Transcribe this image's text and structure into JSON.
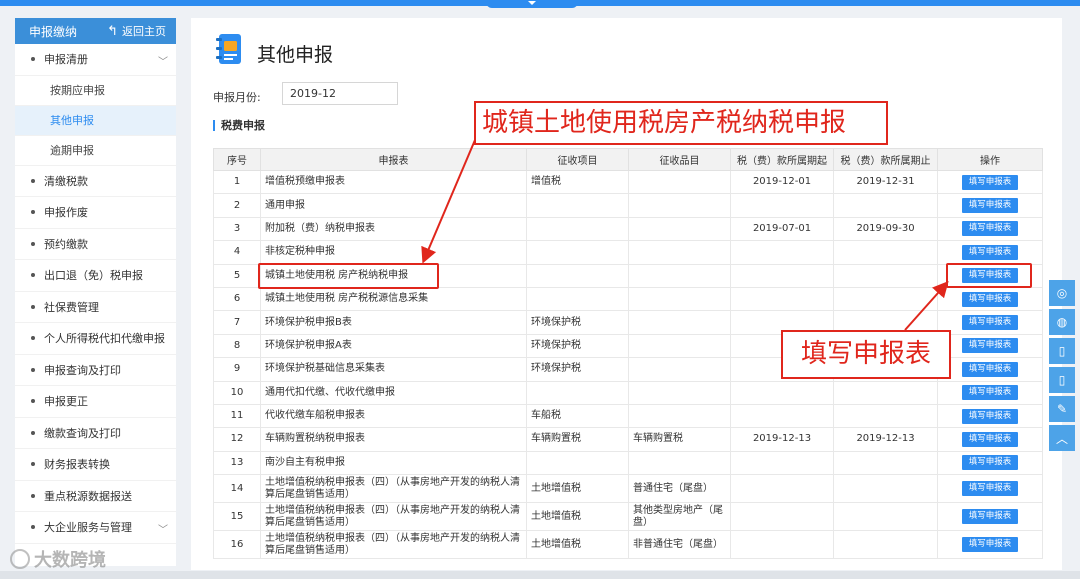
{
  "sidebar": {
    "header_title": "申报缴纳",
    "home_label": "返回主页",
    "items": [
      {
        "label": "申报清册",
        "expanded": true,
        "children": [
          {
            "label": "按期应申报"
          },
          {
            "label": "其他申报",
            "active": true
          },
          {
            "label": "逾期申报"
          }
        ]
      },
      {
        "label": "清缴税款"
      },
      {
        "label": "申报作废"
      },
      {
        "label": "预约缴款"
      },
      {
        "label": "出口退（免）税申报"
      },
      {
        "label": "社保费管理"
      },
      {
        "label": "个人所得税代扣代缴申报"
      },
      {
        "label": "申报查询及打印"
      },
      {
        "label": "申报更正"
      },
      {
        "label": "缴款查询及打印"
      },
      {
        "label": "财务报表转换"
      },
      {
        "label": "重点税源数据报送"
      },
      {
        "label": "大企业服务与管理",
        "expandable": true
      }
    ]
  },
  "main": {
    "title": "其他申报",
    "month_label": "申报月份:",
    "month_value": "2019-12",
    "section_title": "税费申报",
    "table": {
      "headers": [
        "序号",
        "申报表",
        "征收项目",
        "征收品目",
        "税（费）款所属期起",
        "税（费）款所属期止",
        "操作"
      ],
      "action_label": "填写申报表",
      "rows": [
        {
          "no": "1",
          "form": "增值税预缴申报表",
          "item": "增值税",
          "sub": "",
          "start": "2019-12-01",
          "end": "2019-12-31"
        },
        {
          "no": "2",
          "form": "通用申报",
          "item": "",
          "sub": "",
          "start": "",
          "end": ""
        },
        {
          "no": "3",
          "form": "附加税（费）纳税申报表",
          "item": "",
          "sub": "",
          "start": "2019-07-01",
          "end": "2019-09-30"
        },
        {
          "no": "4",
          "form": "非核定税种申报",
          "item": "",
          "sub": "",
          "start": "",
          "end": ""
        },
        {
          "no": "5",
          "form": "城镇土地使用税 房产税纳税申报",
          "item": "",
          "sub": "",
          "start": "",
          "end": ""
        },
        {
          "no": "6",
          "form": "城镇土地使用税 房产税税源信息采集",
          "item": "",
          "sub": "",
          "start": "",
          "end": ""
        },
        {
          "no": "7",
          "form": "环境保护税申报B表",
          "item": "环境保护税",
          "sub": "",
          "start": "",
          "end": ""
        },
        {
          "no": "8",
          "form": "环境保护税申报A表",
          "item": "环境保护税",
          "sub": "",
          "start": "",
          "end": ""
        },
        {
          "no": "9",
          "form": "环境保护税基础信息采集表",
          "item": "环境保护税",
          "sub": "",
          "start": "",
          "end": ""
        },
        {
          "no": "10",
          "form": "通用代扣代缴、代收代缴申报",
          "item": "",
          "sub": "",
          "start": "",
          "end": ""
        },
        {
          "no": "11",
          "form": "代收代缴车船税申报表",
          "item": "车船税",
          "sub": "",
          "start": "",
          "end": ""
        },
        {
          "no": "12",
          "form": "车辆购置税纳税申报表",
          "item": "车辆购置税",
          "sub": "车辆购置税",
          "start": "2019-12-13",
          "end": "2019-12-13"
        },
        {
          "no": "13",
          "form": "南沙自主有税申报",
          "item": "",
          "sub": "",
          "start": "",
          "end": ""
        },
        {
          "no": "14",
          "form": "土地增值税纳税申报表（四）（从事房地产开发的纳税人清算后尾盘销售适用）",
          "item": "土地增值税",
          "sub": "普通住宅（尾盘）",
          "start": "",
          "end": ""
        },
        {
          "no": "15",
          "form": "土地增值税纳税申报表（四）（从事房地产开发的纳税人清算后尾盘销售适用）",
          "item": "土地增值税",
          "sub": "其他类型房地产（尾盘）",
          "start": "",
          "end": ""
        },
        {
          "no": "16",
          "form": "土地增值税纳税申报表（四）（从事房地产开发的纳税人清算后尾盘销售适用）",
          "item": "土地增值税",
          "sub": "非普通住宅（尾盘）",
          "start": "",
          "end": ""
        }
      ]
    }
  },
  "annotations": {
    "callout_form": "城镇土地使用税房产税纳税申报",
    "callout_action": "填写申报表",
    "color": "#e0261c"
  },
  "watermark": "大数跨境",
  "colors": {
    "accent": "#2d8cf0",
    "sidebar_header": "#3b8fd9",
    "rail": "#4da3e8"
  }
}
